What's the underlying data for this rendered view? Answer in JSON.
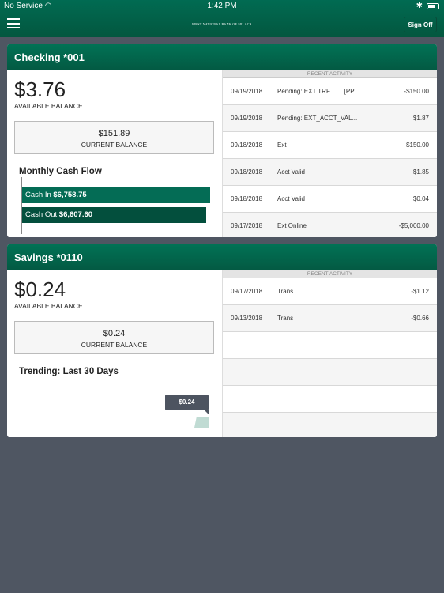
{
  "status_bar": {
    "carrier": "No Service",
    "time": "1:42 PM"
  },
  "header": {
    "bank_name": "FIRST NATIONAL BANK OF MILACA",
    "sign_off": "Sign Off"
  },
  "accounts": [
    {
      "title": "Checking *001",
      "available_balance": "$3.76",
      "available_label": "AVAILABLE BALANCE",
      "current_balance": "$151.89",
      "current_label": "CURRENT BALANCE",
      "section_title": "Monthly Cash Flow",
      "cash_flow": {
        "in_label": "Cash In",
        "in_value": "$6,758.75",
        "in_amount": 6758.75,
        "out_label": "Cash Out",
        "out_value": "$6,607.60",
        "out_amount": 6607.6,
        "in_color": "#046c55",
        "out_color": "#034f3d"
      },
      "recent_activity_label": "RECENT ACTIVITY",
      "transactions": [
        {
          "date": "09/19/2018",
          "desc": "Pending: EXT TRF        [PP...",
          "amount": "-$150.00"
        },
        {
          "date": "09/19/2018",
          "desc": "Pending: EXT_ACCT_VAL...",
          "amount": "$1.87"
        },
        {
          "date": "09/18/2018",
          "desc": "Ext",
          "amount": "$150.00"
        },
        {
          "date": "09/18/2018",
          "desc": "Acct Valid",
          "amount": "$1.85"
        },
        {
          "date": "09/18/2018",
          "desc": "Acct Valid",
          "amount": "$0.04"
        },
        {
          "date": "09/17/2018",
          "desc": "Ext Online",
          "amount": "-$5,000.00"
        }
      ]
    },
    {
      "title": "Savings *0110",
      "available_balance": "$0.24",
      "available_label": "AVAILABLE BALANCE",
      "current_balance": "$0.24",
      "current_label": "CURRENT BALANCE",
      "section_title": "Trending: Last 30 Days",
      "trend_tooltip": "$0.24",
      "recent_activity_label": "RECENT ACTIVITY",
      "transactions": [
        {
          "date": "09/17/2018",
          "desc": "Trans",
          "amount": "-$1.12"
        },
        {
          "date": "09/13/2018",
          "desc": "Trans",
          "amount": "-$0.66"
        }
      ]
    }
  ]
}
